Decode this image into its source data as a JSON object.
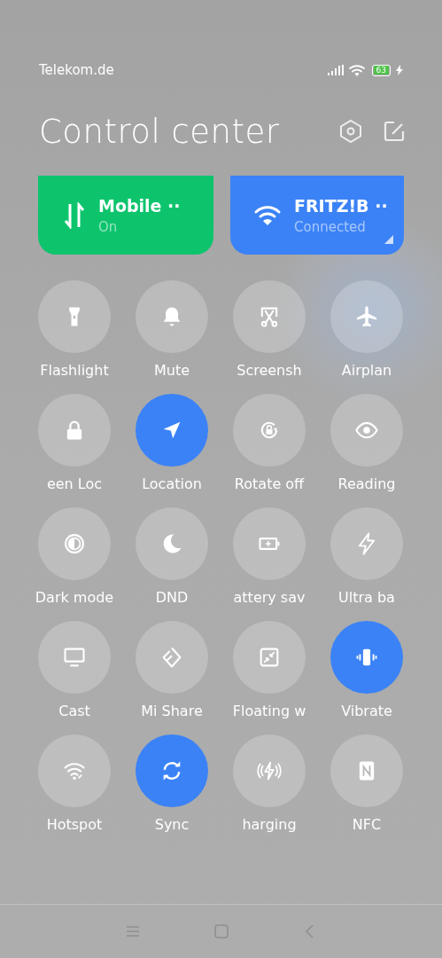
{
  "status_bar": {
    "carrier": "Telekom.de",
    "battery": "63"
  },
  "header": {
    "title": "Control center"
  },
  "cards": [
    {
      "kind": "mobile",
      "title": "Mobile ··",
      "status": "On"
    },
    {
      "kind": "wifi",
      "title": "FRITZ!B ··",
      "status": "Connected"
    }
  ],
  "toggles": [
    {
      "label": "Flashlight",
      "selected": false
    },
    {
      "label": "Mute",
      "selected": false
    },
    {
      "label": "Screensh",
      "selected": false
    },
    {
      "label": "Airplan",
      "selected": false
    },
    {
      "label": "een Loc",
      "selected": false
    },
    {
      "label": "Location",
      "selected": true
    },
    {
      "label": "Rotate off",
      "selected": false
    },
    {
      "label": "Reading",
      "selected": false
    },
    {
      "label": "Dark mode",
      "selected": false
    },
    {
      "label": "DND",
      "selected": false
    },
    {
      "label": "attery sav",
      "selected": false
    },
    {
      "label": "Ultra ba",
      "selected": false
    },
    {
      "label": "Cast",
      "selected": false
    },
    {
      "label": "Mi Share",
      "selected": false
    },
    {
      "label": "Floating w",
      "selected": false
    },
    {
      "label": "Vibrate",
      "selected": true
    },
    {
      "label": "Hotspot",
      "selected": false
    },
    {
      "label": "Sync",
      "selected": true
    },
    {
      "label": "harging",
      "selected": false
    },
    {
      "label": "NFC",
      "selected": false
    }
  ]
}
